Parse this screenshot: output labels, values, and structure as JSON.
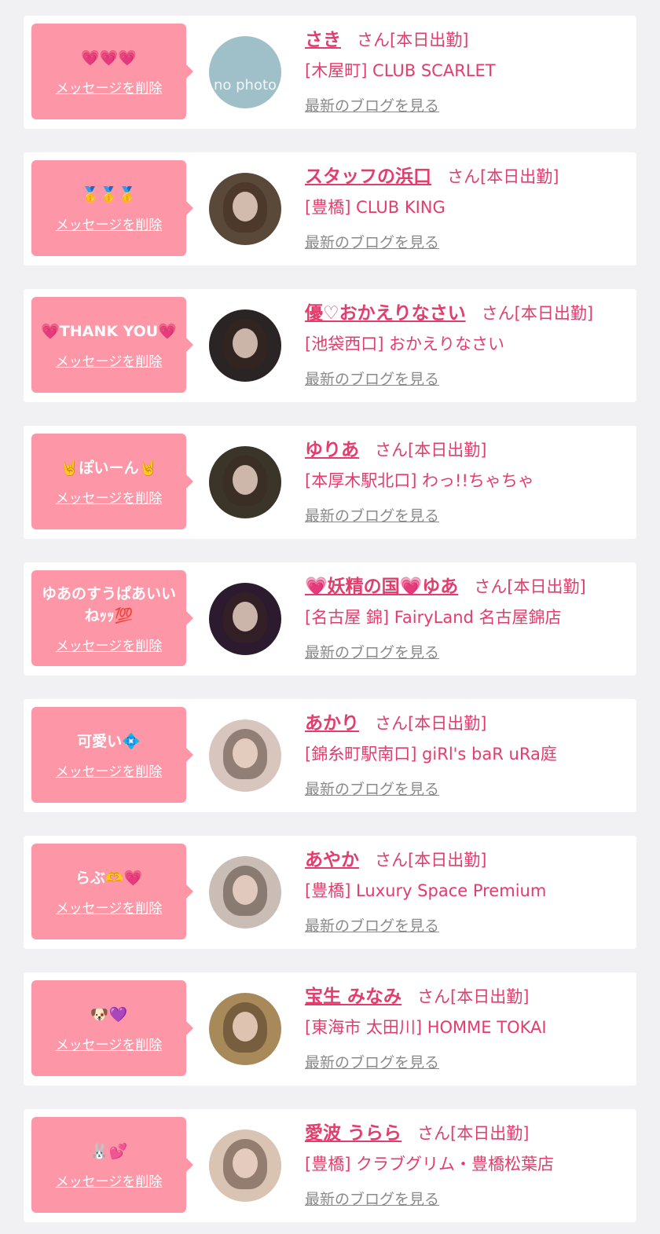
{
  "san_suffix": "さん",
  "cards": [
    {
      "message": "💗💗💗",
      "delete_label": "メッセージを削除",
      "name": "さき",
      "san": "さん",
      "status": "[本日出勤]",
      "shop": "[木屋町] CLUB SCARLET",
      "blog_label": "最新のブログを見る",
      "avatar_text": "no photo",
      "avatar_bg": "#9fc0c9"
    },
    {
      "message": "🥇🥇🥇",
      "delete_label": "メッセージを削除",
      "name": "スタッフの浜口",
      "san": "さん",
      "status": "[本日出勤]",
      "shop": "[豊橋] CLUB KING",
      "blog_label": "最新のブログを見る",
      "avatar_text": "",
      "avatar_bg": "#5a4838"
    },
    {
      "message": "💗THANK YOU💗",
      "delete_label": "メッセージを削除",
      "name": "優♡おかえりなさい",
      "san": "さん",
      "status": "[本日出勤]",
      "shop": "[池袋西口] おかえりなさい",
      "blog_label": "最新のブログを見る",
      "avatar_text": "",
      "avatar_bg": "#2b2424"
    },
    {
      "message": "🤘ぽいーん🤘",
      "delete_label": "メッセージを削除",
      "name": "ゆりあ",
      "san": "さん",
      "status": "[本日出勤]",
      "shop": "[本厚木駅北口] わっ!!ちゃちゃ",
      "blog_label": "最新のブログを見る",
      "avatar_text": "",
      "avatar_bg": "#3b3428"
    },
    {
      "message": "ゆあのすうぱあいいねｯｯ💯",
      "delete_label": "メッセージを削除",
      "name": "💗妖精の国💗ゆあ",
      "san": "さん",
      "status": "[本日出勤]",
      "shop": "[名古屋 錦] FairyLand 名古屋錦店",
      "blog_label": "最新のブログを見る",
      "avatar_text": "",
      "avatar_bg": "#2c1a2e"
    },
    {
      "message": "可愛い💠",
      "delete_label": "メッセージを削除",
      "name": "あかり",
      "san": "さん",
      "status": "[本日出勤]",
      "shop": "[錦糸町駅南口] giRl's baR uRa庭",
      "blog_label": "最新のブログを見る",
      "avatar_text": "",
      "avatar_bg": "#d8c6be"
    },
    {
      "message": "らぶ🫶💗",
      "delete_label": "メッセージを削除",
      "name": "あやか",
      "san": "さん",
      "status": "[本日出勤]",
      "shop": "[豊橋] Luxury Space Premium",
      "blog_label": "最新のブログを見る",
      "avatar_text": "",
      "avatar_bg": "#c9bdb6"
    },
    {
      "message": "🐶💜",
      "delete_label": "メッセージを削除",
      "name": "宝生 みなみ",
      "san": "さん",
      "status": "[本日出勤]",
      "shop": "[東海市 太田川] HOMME TOKAI",
      "blog_label": "最新のブログを見る",
      "avatar_text": "",
      "avatar_bg": "#a88a5a"
    },
    {
      "message": "🐰💕",
      "delete_label": "メッセージを削除",
      "name": "愛波 うらら",
      "san": "さん",
      "status": "[本日出勤]",
      "shop": "[豊橋] クラブグリム・豊橋松葉店",
      "blog_label": "最新のブログを見る",
      "avatar_text": "",
      "avatar_bg": "#d9c3b3"
    }
  ],
  "colors": {
    "accent": "#e23d6c",
    "message_bg": "#fd96a6",
    "link_gray": "#8a8a8a",
    "page_bg": "#f1f1f3"
  }
}
